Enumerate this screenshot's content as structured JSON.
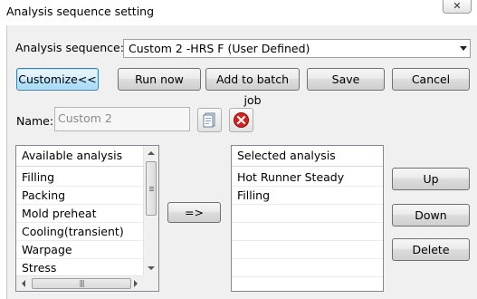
{
  "window": {
    "title": "Analysis sequence setting",
    "close_glyph": "✕"
  },
  "sequence": {
    "label": "Analysis sequence:",
    "selected": "Custom 2 -HRS F  (User Defined)"
  },
  "toolbar": {
    "customize_label": "Customize<<",
    "run_now_label": "Run now",
    "batch_label": "Add to batch job",
    "save_label": "Save",
    "cancel_label": "Cancel"
  },
  "name": {
    "label": "Name:",
    "value": "Custom 2"
  },
  "available": {
    "header": "Available analysis",
    "items": [
      "Filling",
      "Packing",
      "Mold preheat",
      "Cooling(transient)",
      "Warpage",
      "Stress"
    ]
  },
  "transfer": {
    "label": "=>"
  },
  "selected": {
    "header": "Selected analysis",
    "items": [
      "Hot Runner Steady",
      "Filling"
    ]
  },
  "order": {
    "up_label": "Up",
    "down_label": "Down",
    "delete_label": "Delete"
  },
  "colors": {
    "active_button": "#bee6fd",
    "delete_icon_red": "#d9201f"
  },
  "icons": {
    "close": "close-icon",
    "edit": "document-edit-icon",
    "delete": "delete-x-icon"
  }
}
